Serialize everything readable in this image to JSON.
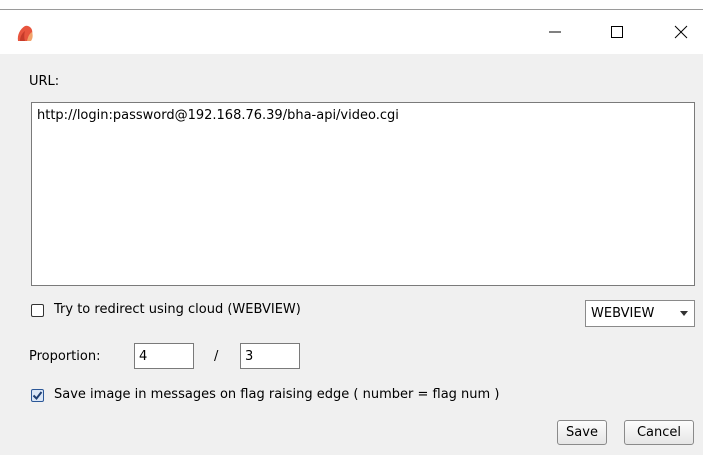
{
  "window": {
    "icon": "app-flame-icon",
    "minimize_glyph": "—",
    "close_glyph": "✕"
  },
  "url": {
    "label": "URL:",
    "value": "http://login:password@192.168.76.39/bha-api/video.cgi"
  },
  "redirect": {
    "label": "Try to redirect using cloud (WEBVIEW)",
    "checked": false
  },
  "mode_select": {
    "value": "WEBVIEW"
  },
  "proportion": {
    "label": "Proportion:",
    "numerator": "4",
    "separator": "/",
    "denominator": "3"
  },
  "save_image": {
    "label": "Save image in messages on flag raising edge ( number = flag num )",
    "checked": true
  },
  "buttons": {
    "save": "Save",
    "cancel": "Cancel"
  },
  "colors": {
    "checkbox_accent": "#2b5797",
    "icon_red": "#e8553e",
    "icon_orange": "#f2a36b"
  }
}
